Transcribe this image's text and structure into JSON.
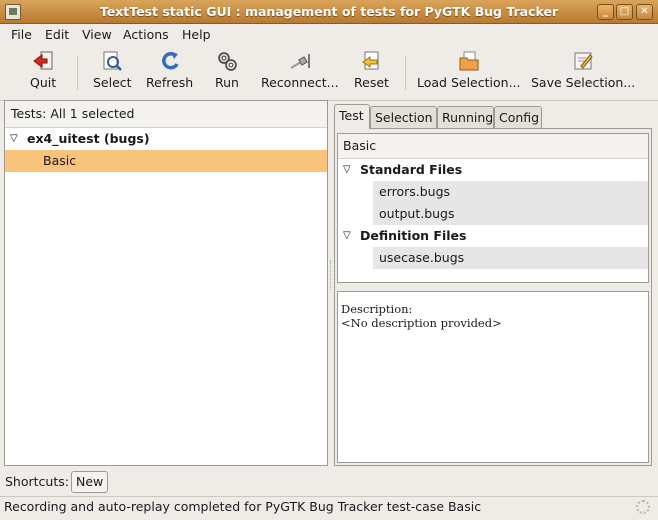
{
  "window": {
    "title": "TextTest static GUI : management of tests for PyGTK Bug Tracker"
  },
  "menu": [
    "File",
    "Edit",
    "View",
    "Actions",
    "Help"
  ],
  "toolbar": {
    "quit": "Quit",
    "select": "Select",
    "refresh": "Refresh",
    "run": "Run",
    "reconnect": "Reconnect...",
    "reset": "Reset",
    "load_selection": "Load Selection...",
    "save_selection": "Save Selection..."
  },
  "tests": {
    "header": "Tests: All 1 selected",
    "suite": "ex4_uitest (bugs)",
    "selected_test": "Basic"
  },
  "tabs": [
    "Test",
    "Selection",
    "Running",
    "Config"
  ],
  "files": {
    "header": "Basic",
    "categories": [
      {
        "name": "Standard Files",
        "files": [
          "errors.bugs",
          "output.bugs"
        ]
      },
      {
        "name": "Definition Files",
        "files": [
          "usecase.bugs"
        ]
      }
    ]
  },
  "description": {
    "line1": "Description:",
    "line2": "<No description provided>"
  },
  "shortcuts": {
    "label": "Shortcuts:",
    "new_button": "New"
  },
  "status": {
    "text": "Recording and auto-replay completed for PyGTK Bug Tracker test-case Basic"
  },
  "colors": {
    "accent": "#d59a4e",
    "selection": "#f8c37a"
  }
}
